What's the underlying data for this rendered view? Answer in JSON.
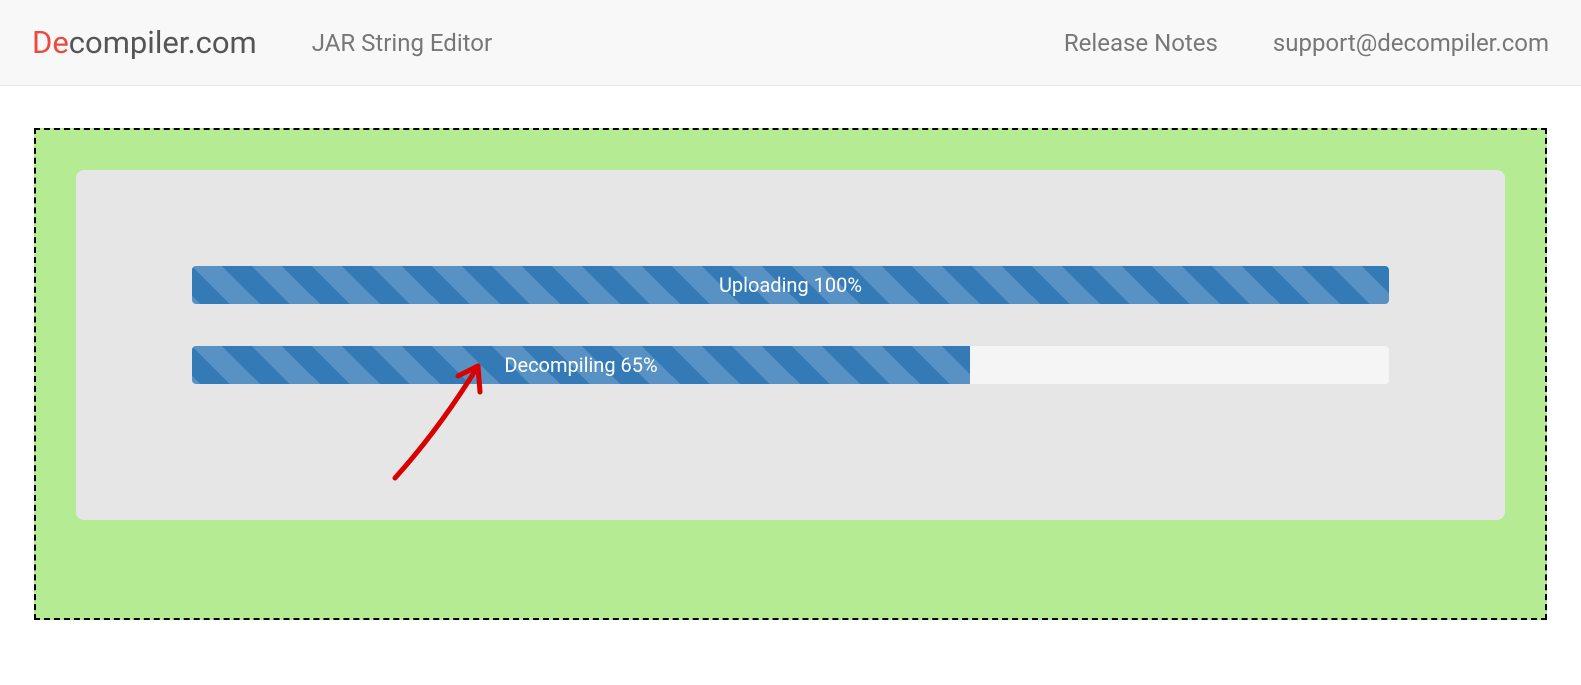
{
  "brand": {
    "accent": "De",
    "rest": "compiler.com"
  },
  "nav": {
    "left": [
      "JAR String Editor"
    ],
    "right": [
      "Release Notes",
      "support@decompiler.com"
    ]
  },
  "progress": {
    "upload": {
      "label": "Uploading 100%",
      "percent": 100
    },
    "decompile": {
      "label": "Decompiling 65%",
      "percent": 65
    }
  },
  "colors": {
    "brand_accent": "#e74c3c",
    "dropzone_bg": "#b4eb93",
    "panel_bg": "#e6e6e6",
    "progress_fill": "#337ab7",
    "annotation": "#d90000"
  }
}
